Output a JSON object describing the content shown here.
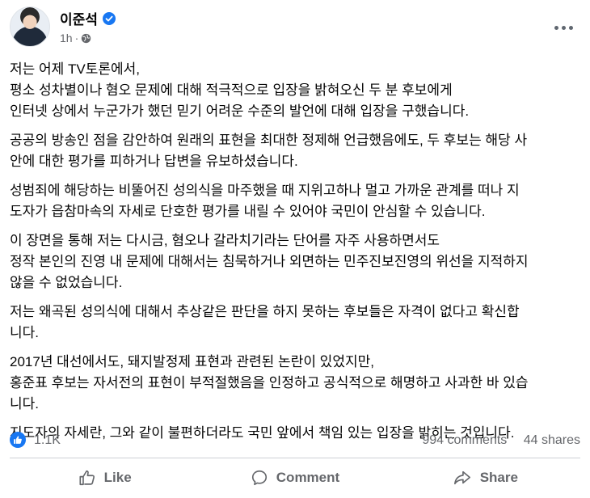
{
  "post": {
    "author": "이준석",
    "time": "1h",
    "paragraphs": [
      [
        "저는 어제 TV토론에서,",
        "평소 성차별이나 혐오 문제에 대해 적극적으로 입장을 밝혀오신 두 분 후보에게",
        "인터넷 상에서 누군가가 했던 믿기 어려운 수준의 발언에 대해 입장을 구했습니다."
      ],
      [
        "공공의 방송인 점을 감안하여 원래의 표현을 최대한 정제해 언급했음에도, 두 후보는 해당 사",
        "안에 대한 평가를 피하거나 답변을 유보하셨습니다."
      ],
      [
        "성범죄에 해당하는 비뚤어진 성의식을 마주했을 때 지위고하나 멀고 가까운 관계를 떠나 지",
        "도자가 읍참마속의 자세로 단호한 평가를 내릴 수 있어야 국민이 안심할 수 있습니다."
      ],
      [
        "이 장면을 통해 저는 다시금, 혐오나 갈라치기라는 단어를 자주 사용하면서도",
        "정작 본인의 진영 내 문제에 대해서는 침묵하거나 외면하는 민주진보진영의 위선을 지적하지",
        "않을 수 없었습니다."
      ],
      [
        "저는 왜곡된 성의식에 대해서 추상같은 판단을 하지 못하는 후보들은 자격이 없다고 확신합",
        "니다."
      ],
      [
        "2017년 대선에서도, 돼지발정제 표현과 관련된 논란이 있었지만,",
        "홍준표 후보는 자서전의 표현이 부적절했음을 인정하고 공식적으로 해명하고 사과한 바 있습",
        "니다."
      ],
      [
        "지도자의 자세란, 그와 같이 불편하더라도 국민 앞에서 책임 있는 입장을 밝히는 것입니다."
      ]
    ]
  },
  "stats": {
    "likes": "1.1K",
    "comments": "994 comments",
    "shares": "44 shares"
  },
  "actions": {
    "like": "Like",
    "comment": "Comment",
    "share": "Share"
  },
  "colors": {
    "accent": "#1877f2",
    "muted": "#65676b"
  }
}
